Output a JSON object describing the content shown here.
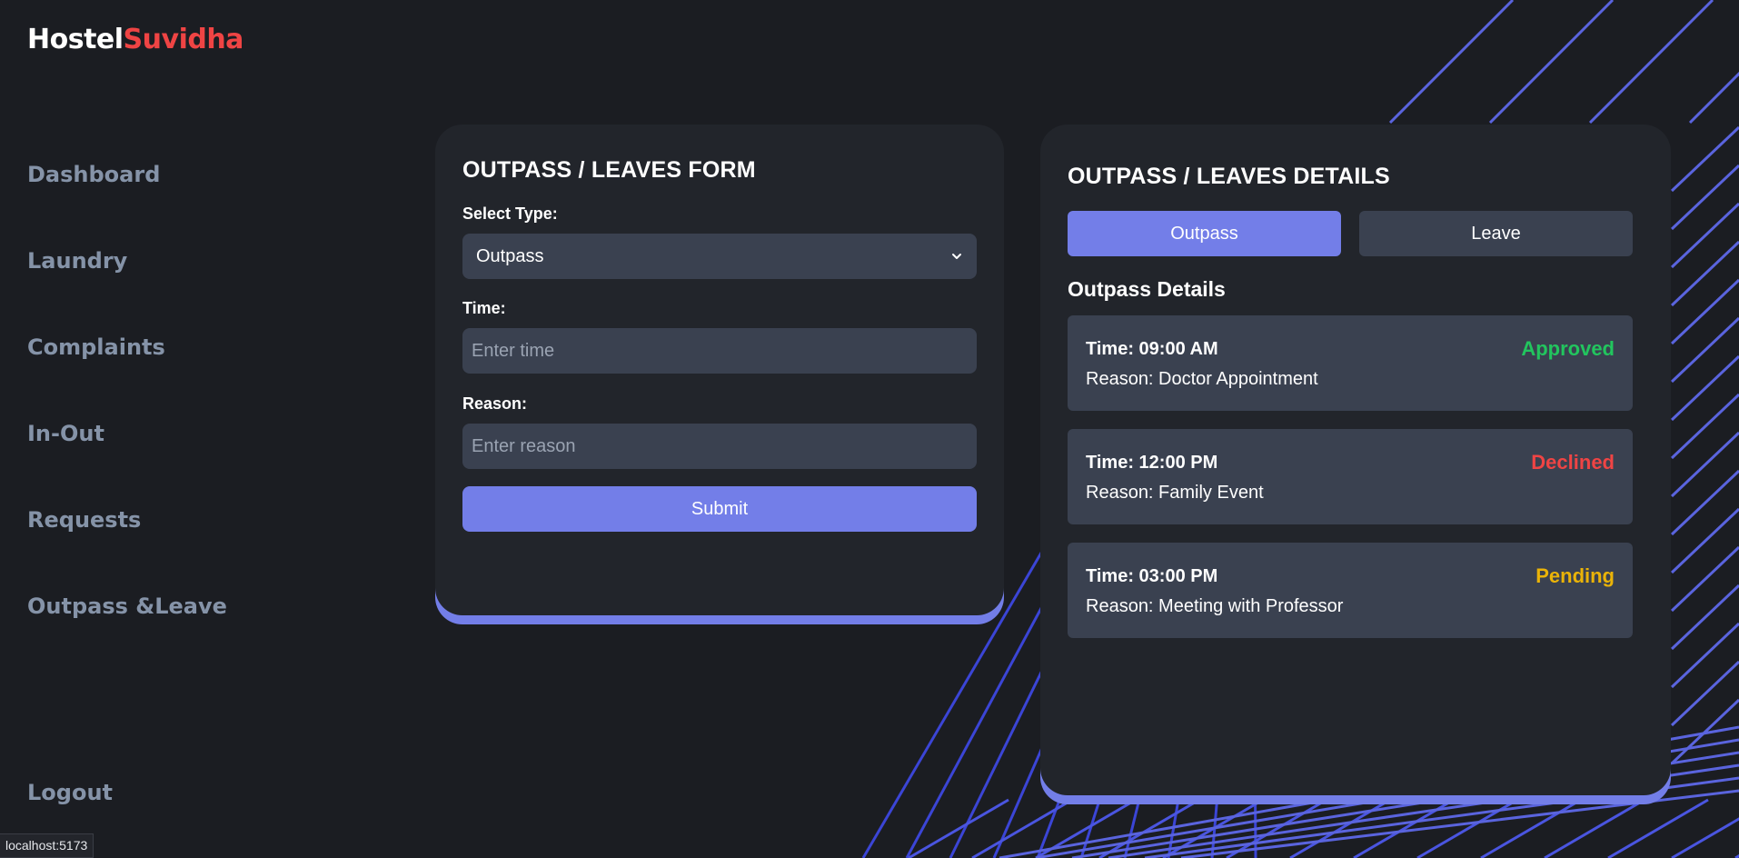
{
  "brand": {
    "part1": "Hostel",
    "part2": "Suvidha"
  },
  "sidebar": {
    "items": [
      {
        "label": "Dashboard"
      },
      {
        "label": "Laundry"
      },
      {
        "label": "Complaints"
      },
      {
        "label": "In-Out"
      },
      {
        "label": "Requests"
      },
      {
        "label": "Outpass &Leave"
      }
    ],
    "logout": "Logout"
  },
  "form": {
    "title": "OUTPASS / LEAVES FORM",
    "type_label": "Select Type:",
    "type_value": "Outpass",
    "time_label": "Time:",
    "time_placeholder": "Enter time",
    "reason_label": "Reason:",
    "reason_placeholder": "Enter reason",
    "submit_label": "Submit"
  },
  "details": {
    "title": "OUTPASS / LEAVES DETAILS",
    "tabs": [
      {
        "label": "Outpass",
        "active": true
      },
      {
        "label": "Leave",
        "active": false
      }
    ],
    "section_title": "Outpass Details",
    "entries": [
      {
        "time": "Time: 09:00 AM",
        "reason": "Reason: Doctor Appointment",
        "status": "Approved",
        "status_color": "#22c55e"
      },
      {
        "time": "Time: 12:00 PM",
        "reason": "Reason: Family Event",
        "status": "Declined",
        "status_color": "#ef4444"
      },
      {
        "time": "Time: 03:00 PM",
        "reason": "Reason: Meeting with Professor",
        "status": "Pending",
        "status_color": "#eab308"
      }
    ]
  },
  "status_bar": {
    "url": "localhost:5173"
  },
  "colors": {
    "background": "#1b1d22",
    "card": "#22252b",
    "accent": "#737ee8",
    "field": "#3a4150",
    "brand_red": "#ef4444",
    "nav_text": "#8593a8"
  }
}
